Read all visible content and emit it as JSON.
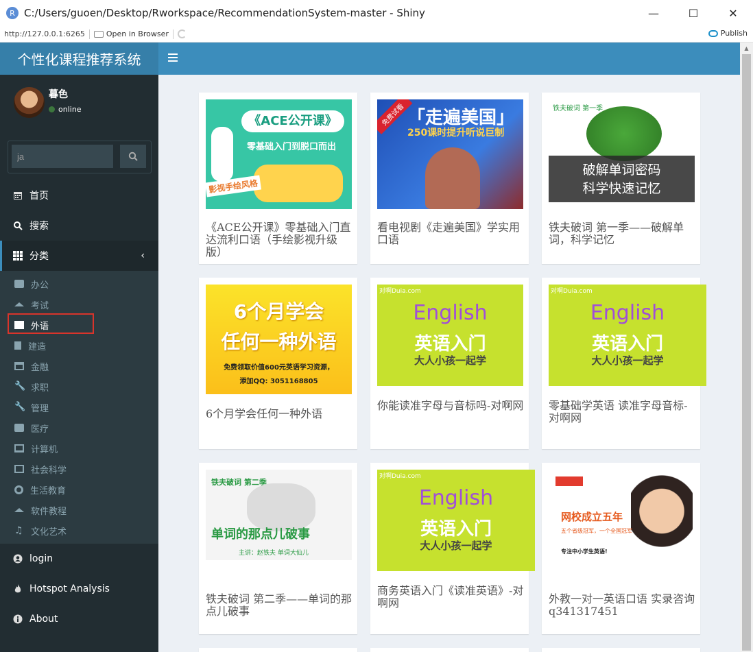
{
  "window": {
    "title": "C:/Users/guoen/Desktop/Rworkspace/RecommendationSystem-master - Shiny",
    "app_icon": "R",
    "url": "http://127.0.0.1:6265",
    "open_browser": "Open in Browser",
    "publish": "Publish"
  },
  "header": {
    "brand": "个性化课程推荐系统"
  },
  "user": {
    "name": "暮色",
    "status": "online"
  },
  "search": {
    "value": "ja"
  },
  "menu": {
    "home": "首页",
    "search": "搜索",
    "category": "分类",
    "sub": [
      "办公",
      "考试",
      "外语",
      "建造",
      "金融",
      "求职",
      "管理",
      "医疗",
      "计算机",
      "社会科学",
      "生活教育",
      "软件教程",
      "文化艺术"
    ],
    "login": "login",
    "hotspot": "Hotspot Analysis",
    "about": "About"
  },
  "cards": [
    {
      "title": "《ACE公开课》零基础入门直达流利口语（手绘影视升级版）",
      "img_lines": [
        "《ACE公开课》",
        "零基础入门到脱口而出",
        "影视手绘风格"
      ]
    },
    {
      "title": "看电视剧《走遍美国》学实用口语",
      "img_lines": [
        "「走遍美国」",
        "250课时提升听说巨制",
        "免费试看"
      ]
    },
    {
      "title": "铁夫破词 第一季——破解单词，科学记忆",
      "img_lines": [
        "铁夫破词 第一季",
        "破解单词密码",
        "科学快速记忆"
      ]
    },
    {
      "title": "6个月学会任何一种外语",
      "img_lines": [
        "6个月学会",
        "任何一种外语",
        "免费领取价值600元英语学习资源，",
        "添加QQ: 3051168805"
      ]
    },
    {
      "title": "你能读准字母与音标吗-对啊网",
      "img_lines": [
        "对啊Duia.com",
        "English",
        "英语入门",
        "大人小孩一起学"
      ]
    },
    {
      "title": "零基础学英语 读准字母音标-对啊网",
      "img_lines": [
        "对啊Duia.com",
        "English",
        "英语入门",
        "大人小孩一起学"
      ]
    },
    {
      "title": "铁夫破词 第二季——单词的那点儿破事",
      "img_lines": [
        "铁夫破词  第二季",
        "单词的那点儿破事",
        "主讲：赵铁夫    单词大仙儿"
      ]
    },
    {
      "title": "商务英语入门《读准英语》-对啊网",
      "img_lines": [
        "对啊Duia.com",
        "English",
        "英语入门",
        "大人小孩一起学"
      ]
    },
    {
      "title": "外教一对一英语口语 实录咨询q341317451",
      "img_lines": [
        "网校成立五年",
        "五个省级冠军，一个全国冠军",
        "专注中小学生英语!"
      ]
    }
  ],
  "colors": {
    "sidebar": "#222d32",
    "header": "#3c8dbc",
    "logo": "#367fa9",
    "content_bg": "#ecf0f5"
  }
}
